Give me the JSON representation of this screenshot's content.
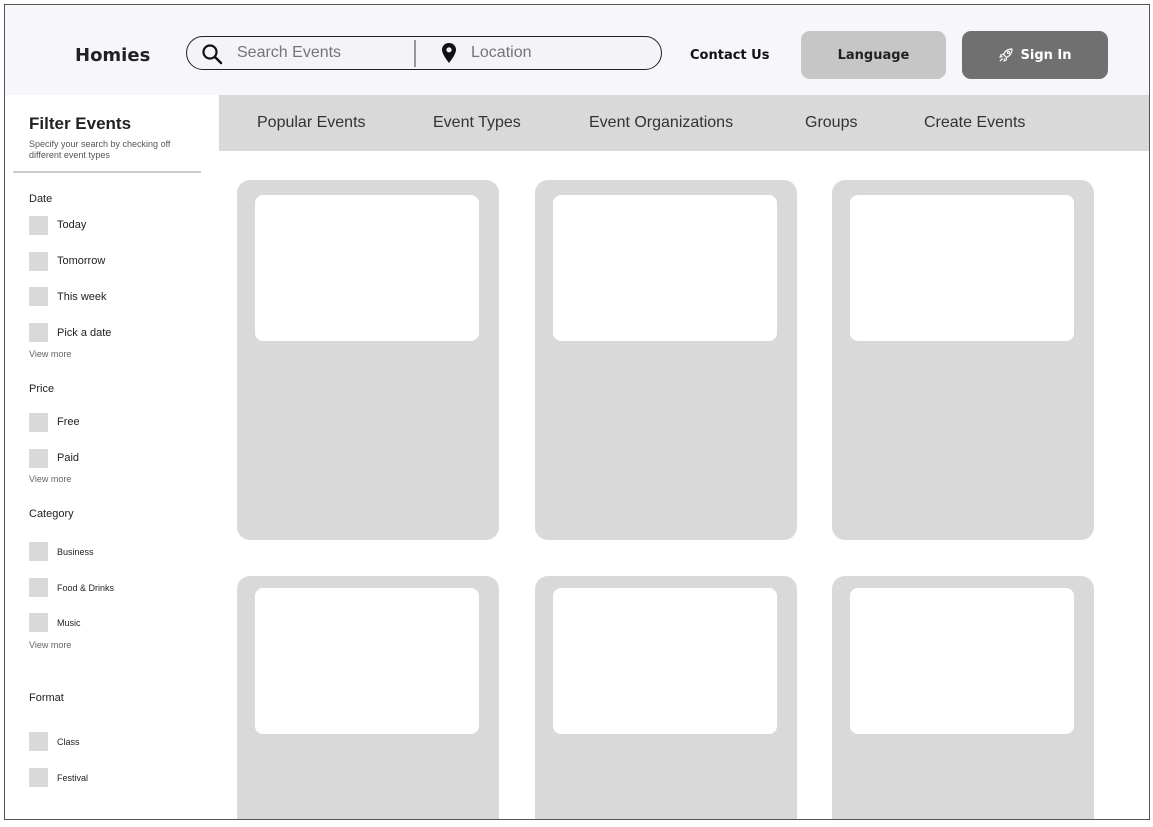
{
  "header": {
    "brand": "Homies",
    "search_placeholder": "Search Events",
    "location_placeholder": "Location",
    "contact_label": "Contact Us",
    "language_label": "Language",
    "signin_label": "Sign In"
  },
  "nav": {
    "tabs": [
      "Popular Events",
      "Event Types",
      "Event Organizations",
      "Groups",
      "Create Events"
    ]
  },
  "sidebar": {
    "title": "Filter Events",
    "subtitle": "Specify your search by checking off different event types",
    "date": {
      "heading": "Date",
      "options": [
        "Today",
        "Tomorrow",
        "This week",
        "Pick a date"
      ],
      "more": "View more"
    },
    "price": {
      "heading": "Price",
      "options": [
        "Free",
        "Paid"
      ],
      "more": "View more"
    },
    "category": {
      "heading": "Category",
      "options": [
        "Business",
        "Food & Drinks",
        "Music"
      ],
      "more": "View more"
    },
    "format": {
      "heading": "Format",
      "options": [
        "Class",
        "Festival"
      ]
    }
  },
  "icons": {
    "search": "search-icon",
    "location": "location-pin-icon",
    "signin": "rocket-icon"
  },
  "colors": {
    "header_bg": "#f6f6fb",
    "nav_bg": "#d9d9d9",
    "card_bg": "#d9d9d9",
    "signin_bg": "#707070",
    "language_bg": "#c6c6c6"
  }
}
